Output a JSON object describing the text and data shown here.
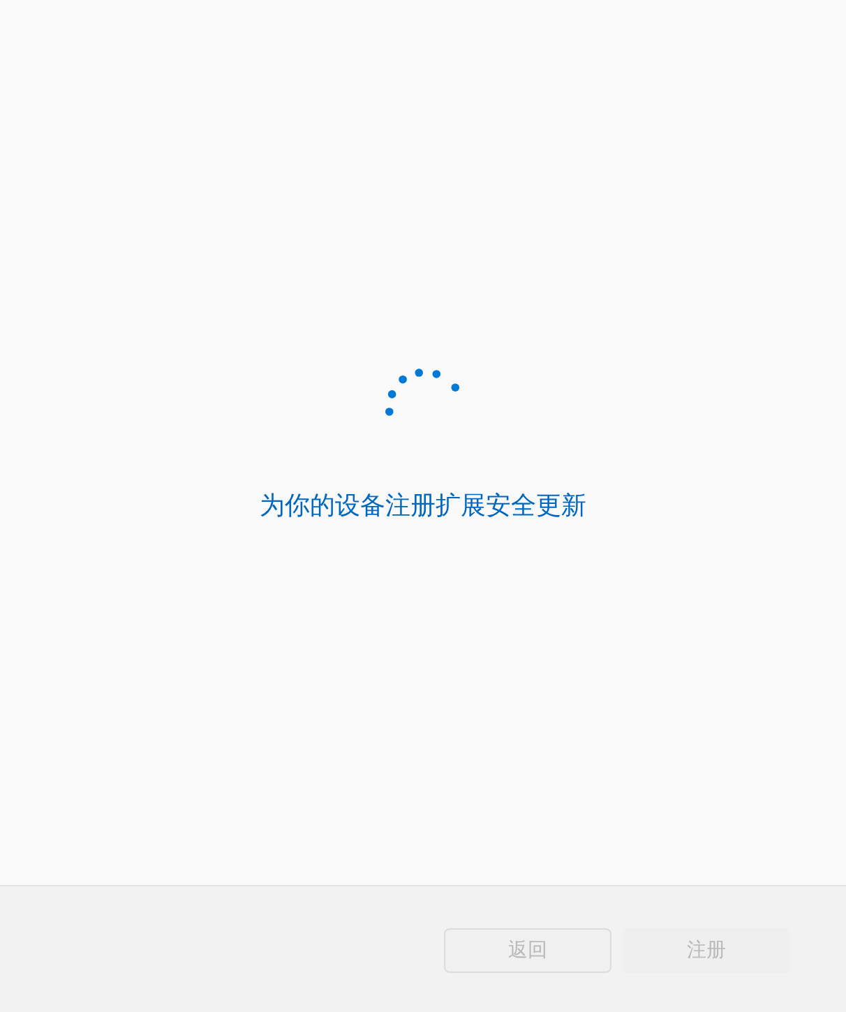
{
  "message": "为你的设备注册扩展安全更新",
  "buttons": [
    {
      "label": "返回",
      "kind": "secondary",
      "disabled": true
    },
    {
      "label": "注册",
      "kind": "primary",
      "disabled": true
    }
  ]
}
